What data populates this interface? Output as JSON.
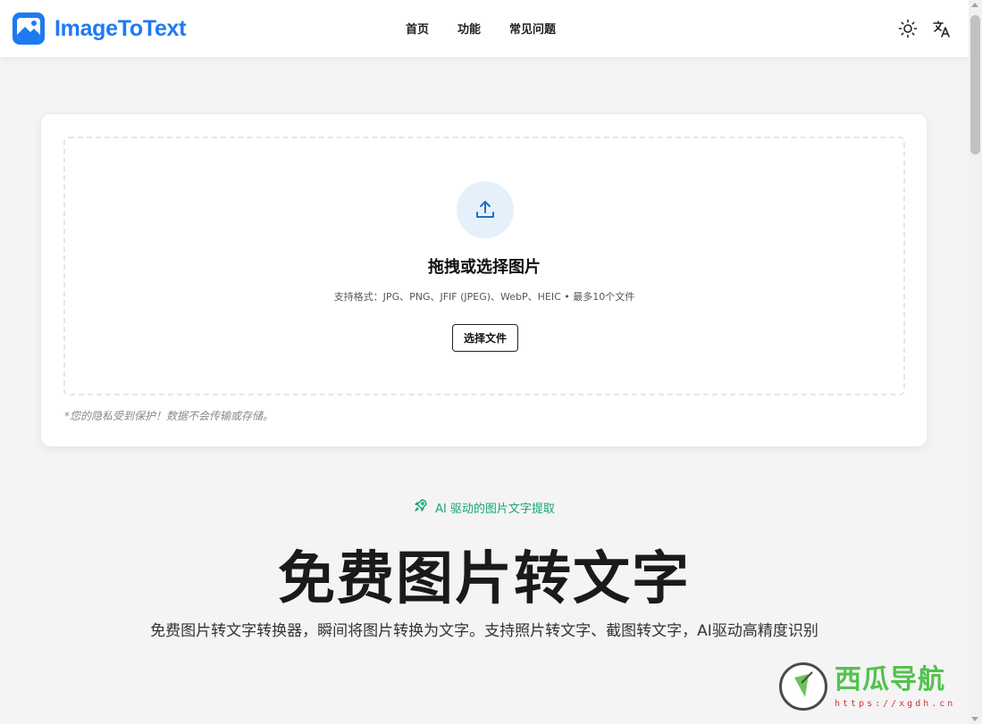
{
  "header": {
    "logo_text": "ImageToText",
    "nav": [
      "首页",
      "功能",
      "常见问题"
    ],
    "icons": [
      "sun-icon",
      "translate-icon"
    ]
  },
  "upload": {
    "title": "拖拽或选择图片",
    "formats": "支持格式：JPG、PNG、JFIF (JPEG)、WebP、HEIC • 最多10个文件",
    "button": "选择文件",
    "privacy": "*您的隐私受到保护！数据不会传输或存储。"
  },
  "hero": {
    "badge": "AI 驱动的图片文字提取",
    "title": "免费图片转文字",
    "subtitle": "免费图片转文字转换器，瞬间将图片转换为文字。支持照片转文字、截图转文字，AI驱动高精度识别"
  },
  "watermark": {
    "title": "西瓜导航",
    "url": "https://xgdh.cn"
  },
  "colors": {
    "brand": "#1d7af3",
    "accent_green": "#16a37a",
    "background": "#f4f4f5"
  }
}
